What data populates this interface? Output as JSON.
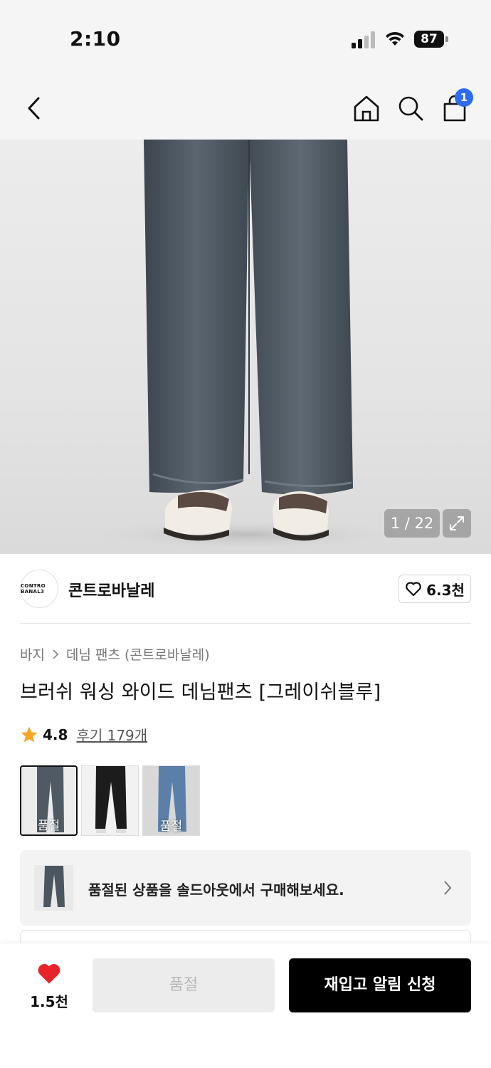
{
  "status_bar": {
    "time": "2:10",
    "battery": "87"
  },
  "header": {
    "cart_count": "1",
    "icons": [
      "back-arrow-icon",
      "home-icon",
      "search-icon",
      "cart-icon"
    ]
  },
  "gallery": {
    "counter": "1 / 22",
    "current_image": 1,
    "total_images": 22
  },
  "brand": {
    "logo_text": "CONTRO BANAL3",
    "name": "콘트로바날레",
    "likes": "6.3천"
  },
  "breadcrumb": {
    "items": [
      "바지",
      "데님 팬츠 (콘트로바날레)"
    ]
  },
  "product": {
    "title": "브러쉬 워싱 와이드 데님팬츠 [그레이쉬블루]",
    "rating": "4.8",
    "reviews": "후기 179개"
  },
  "swatches": [
    {
      "label": "품절",
      "color": "#4f5a64",
      "selected": true
    },
    {
      "label": "",
      "color": "#1c1c1c",
      "selected": false
    },
    {
      "label": "품절",
      "color": "#5b7fa8",
      "selected": false
    }
  ],
  "soldout_banner": {
    "text": "품절된 상품을 솔드아웃에서 구매해보세요."
  },
  "bottom_bar": {
    "wish_count": "1.5천",
    "soldout_button": "품절",
    "restock_button": "재입고 알림 신청"
  },
  "colors": {
    "accent_blue": "#2f6bf1",
    "heart_red": "#e8242b",
    "star_orange": "#f5a623",
    "denim": "#4b5660"
  }
}
